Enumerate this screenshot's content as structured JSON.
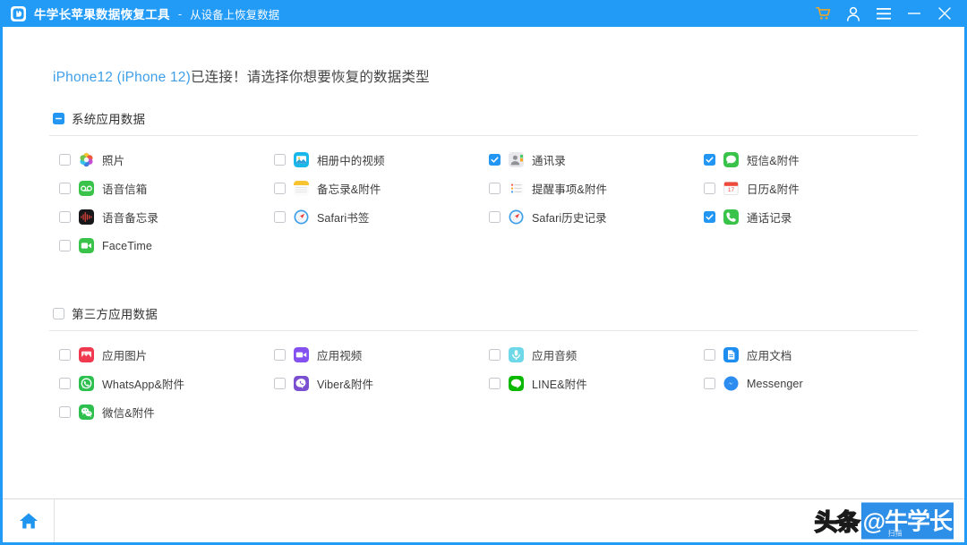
{
  "titlebar": {
    "logo_icon": "app-logo-icon",
    "title": "牛学长苹果数据恢复工具",
    "separator": "-",
    "subtitle": "从设备上恢复数据",
    "controls": [
      {
        "name": "cart-icon",
        "label": "购物车"
      },
      {
        "name": "account-icon",
        "label": "账户"
      },
      {
        "name": "menu-icon",
        "label": "菜单"
      },
      {
        "name": "minimize-icon",
        "label": "最小化"
      },
      {
        "name": "close-icon",
        "label": "关闭"
      }
    ],
    "accent_color": "#229bf7",
    "cart_color": "#f5a623"
  },
  "header": {
    "device_name": "iPhone12 (iPhone 12)",
    "device_message": "已连接！请选择你想要恢复的数据类型",
    "device_name_color": "#3f9fe8"
  },
  "sections": [
    {
      "id": "system-data",
      "title": "系统应用数据",
      "checkbox_state": "indeterminate",
      "items": [
        {
          "label": "照片",
          "icon": "photos-icon",
          "checked": false
        },
        {
          "label": "相册中的视频",
          "icon": "album-video-icon",
          "checked": false
        },
        {
          "label": "通讯录",
          "icon": "contacts-icon",
          "checked": true
        },
        {
          "label": "短信&附件",
          "icon": "messages-icon",
          "checked": true
        },
        {
          "label": "语音信箱",
          "icon": "voicemail-icon",
          "checked": false
        },
        {
          "label": "备忘录&附件",
          "icon": "notes-icon",
          "checked": false
        },
        {
          "label": "提醒事项&附件",
          "icon": "reminders-icon",
          "checked": false
        },
        {
          "label": "日历&附件",
          "icon": "calendar-icon",
          "checked": false
        },
        {
          "label": "语音备忘录",
          "icon": "voice-memos-icon",
          "checked": false
        },
        {
          "label": "Safari书签",
          "icon": "safari-icon",
          "checked": false
        },
        {
          "label": "Safari历史记录",
          "icon": "safari-icon",
          "checked": false
        },
        {
          "label": "通话记录",
          "icon": "phone-icon",
          "checked": true
        },
        {
          "label": "FaceTime",
          "icon": "facetime-icon",
          "checked": false
        }
      ]
    },
    {
      "id": "third-party-data",
      "title": "第三方应用数据",
      "checkbox_state": "unchecked",
      "items": [
        {
          "label": "应用图片",
          "icon": "app-photos-icon",
          "checked": false
        },
        {
          "label": "应用视频",
          "icon": "app-video-icon",
          "checked": false
        },
        {
          "label": "应用音频",
          "icon": "app-audio-icon",
          "checked": false
        },
        {
          "label": "应用文档",
          "icon": "app-document-icon",
          "checked": false
        },
        {
          "label": "WhatsApp&附件",
          "icon": "whatsapp-icon",
          "checked": false
        },
        {
          "label": "Viber&附件",
          "icon": "viber-icon",
          "checked": false
        },
        {
          "label": "LINE&附件",
          "icon": "line-icon",
          "checked": false
        },
        {
          "label": "Messenger",
          "icon": "messenger-icon",
          "checked": false
        },
        {
          "label": "微信&附件",
          "icon": "wechat-icon",
          "checked": false
        }
      ]
    }
  ],
  "footer": {
    "home_icon": "home-icon",
    "watermark_outline": "头条",
    "watermark_highlight": "@牛学长",
    "watermark_subtext": "扫描",
    "watermark_highlight_color": "#2d8fe8"
  }
}
